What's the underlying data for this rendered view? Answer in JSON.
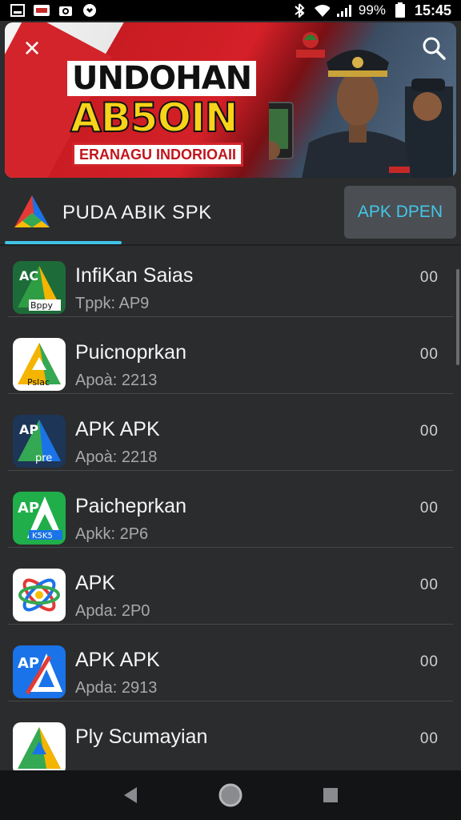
{
  "status_bar": {
    "battery": "99%",
    "time": "15:45",
    "icons": [
      "screenshot-icon",
      "app-badge-icon",
      "camera-icon",
      "shield-icon",
      "bluetooth-off-icon",
      "wifi-icon",
      "signal-icon",
      "battery-icon"
    ]
  },
  "banner": {
    "headline_line1": "UNDOHAN",
    "headline_line2": "AB5OIN",
    "tagline": "ERANAGU INDORIOAII",
    "colors": {
      "red": "#d3242b",
      "yellow": "#f7d31a"
    }
  },
  "app_header": {
    "title": "PUDA ABIK SPK",
    "open_button": "APK DPEN",
    "accent": "#41c2e6"
  },
  "list": [
    {
      "name": "InfiKan Saias",
      "meta": "Tppk: AP9",
      "size": "00",
      "icon_label": "Bppy",
      "icon_badge": "AC",
      "colors": [
        "#2f9d44",
        "#f4b400"
      ]
    },
    {
      "name": "Puicnoprkan",
      "meta": "Apoà: 2213",
      "size": "00",
      "icon_label": "Pslac",
      "icon_badge": "",
      "colors": [
        "#f4b400",
        "#34a853"
      ]
    },
    {
      "name": "APK APK",
      "meta": "Apoà: 2218",
      "size": "00",
      "icon_label": "pre",
      "icon_badge": "AP",
      "colors": [
        "#34a853",
        "#1a73e8"
      ]
    },
    {
      "name": "Paicheprkan",
      "meta": "Apkk: 2P6",
      "size": "00",
      "icon_label": "K5K5",
      "icon_badge": "AP",
      "colors": [
        "#1fae4a",
        "#1a73e8"
      ]
    },
    {
      "name": "APK",
      "meta": "Apda: 2P0",
      "size": "00",
      "icon_label": "",
      "icon_badge": "",
      "colors": [
        "#e53935",
        "#1a73e8"
      ]
    },
    {
      "name": "APK APK",
      "meta": "Apda: 2913",
      "size": "00",
      "icon_label": "",
      "icon_badge": "AP",
      "colors": [
        "#1a73e8",
        "#e53935"
      ]
    },
    {
      "name": "Ply Scumayian",
      "meta": "",
      "size": "00",
      "icon_label": "",
      "icon_badge": "",
      "colors": [
        "#34a853",
        "#f4b400"
      ]
    }
  ],
  "nav": {
    "icons": [
      "back-icon",
      "home-icon",
      "recents-icon"
    ]
  }
}
